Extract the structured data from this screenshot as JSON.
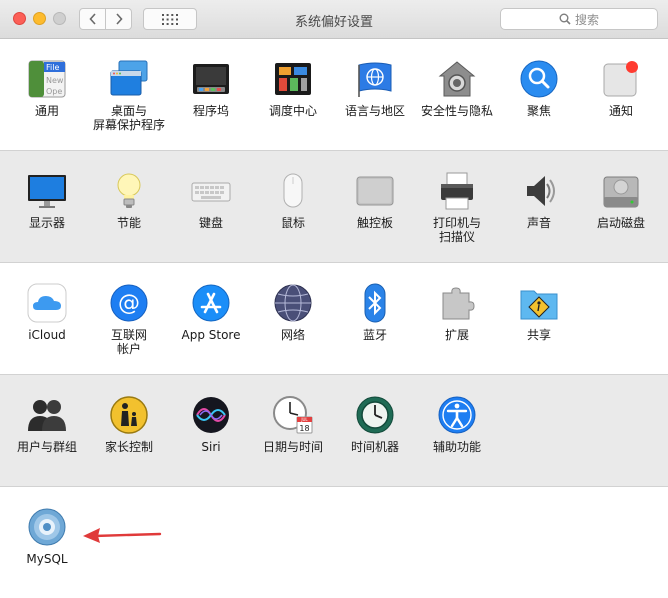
{
  "window": {
    "title": "系统偏好设置",
    "search_placeholder": "搜索"
  },
  "rows": [
    {
      "items": [
        {
          "label": "通用"
        },
        {
          "label": "桌面与\n屏幕保护程序"
        },
        {
          "label": "程序坞"
        },
        {
          "label": "调度中心"
        },
        {
          "label": "语言与地区"
        },
        {
          "label": "安全性与隐私"
        },
        {
          "label": "聚焦"
        },
        {
          "label": "通知"
        }
      ]
    },
    {
      "items": [
        {
          "label": "显示器"
        },
        {
          "label": "节能"
        },
        {
          "label": "键盘"
        },
        {
          "label": "鼠标"
        },
        {
          "label": "触控板"
        },
        {
          "label": "打印机与\n扫描仪"
        },
        {
          "label": "声音"
        },
        {
          "label": "启动磁盘"
        }
      ]
    },
    {
      "items": [
        {
          "label": "iCloud"
        },
        {
          "label": "互联网\n帐户"
        },
        {
          "label": "App Store"
        },
        {
          "label": "网络"
        },
        {
          "label": "蓝牙"
        },
        {
          "label": "扩展"
        },
        {
          "label": "共享"
        }
      ]
    },
    {
      "items": [
        {
          "label": "用户与群组"
        },
        {
          "label": "家长控制"
        },
        {
          "label": "Siri"
        },
        {
          "label": "日期与时间"
        },
        {
          "label": "时间机器"
        },
        {
          "label": "辅助功能"
        }
      ]
    },
    {
      "items": [
        {
          "label": "MySQL"
        }
      ]
    }
  ],
  "icon_text": {
    "general_file": "File",
    "general_new": "New",
    "general_open": "Ope",
    "calendar_month": "JUL",
    "calendar_day": "18"
  },
  "colors": {
    "annotation_arrow": "#e03a3a",
    "notification_dot": "#ff3b30",
    "accent_blue": "#1e7ef2"
  }
}
